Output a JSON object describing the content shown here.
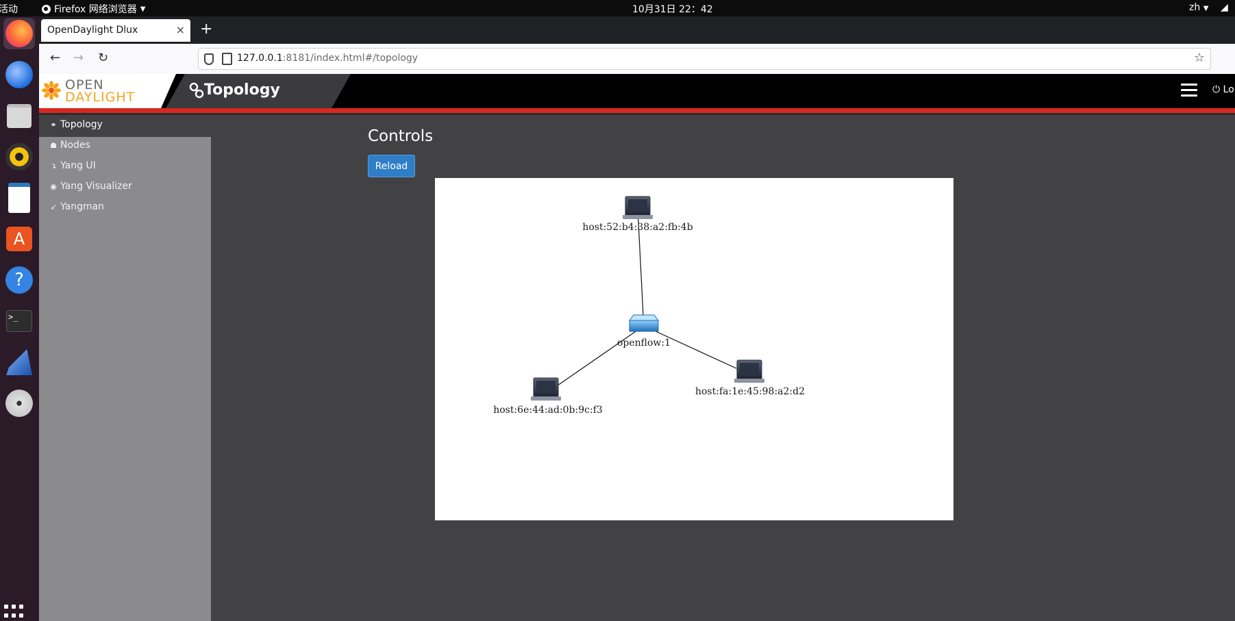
{
  "system": {
    "activities": "活动",
    "app_name": "Firefox 网络浏览器",
    "clock": "10月31日  22：42",
    "lang": "zh"
  },
  "browser": {
    "tab_title": "OpenDaylight Dlux",
    "new_tab": "+",
    "url_host": "127.0.0.1",
    "url_rest": ":8181/index.html#/topology"
  },
  "header": {
    "logo_top": "OPEN",
    "logo_bottom": "DAYLIGHT",
    "active_tab": "Topology",
    "logout": "Lo"
  },
  "sidebar": {
    "items": [
      {
        "label": "Topology",
        "icon": "link-icon"
      },
      {
        "label": "Nodes",
        "icon": "sitemap-icon"
      },
      {
        "label": "Yang UI",
        "icon": "level-down-icon"
      },
      {
        "label": "Yang Visualizer",
        "icon": "eye-icon"
      },
      {
        "label": "Yangman",
        "icon": "rocket-icon"
      }
    ]
  },
  "main": {
    "title": "Controls",
    "reload_label": "Reload"
  },
  "topology": {
    "nodes": [
      {
        "id": "host1",
        "label": "host:52:b4:38:a2:fb:4b",
        "type": "host"
      },
      {
        "id": "switch",
        "label": "openflow:1",
        "type": "switch"
      },
      {
        "id": "host2",
        "label": "host:6e:44:ad:0b:9c:f3",
        "type": "host"
      },
      {
        "id": "host3",
        "label": "host:fa:1e:45:98:a2:d2",
        "type": "host"
      }
    ],
    "links": [
      {
        "from": "switch",
        "to": "host1"
      },
      {
        "from": "switch",
        "to": "host2"
      },
      {
        "from": "switch",
        "to": "host3"
      }
    ]
  }
}
